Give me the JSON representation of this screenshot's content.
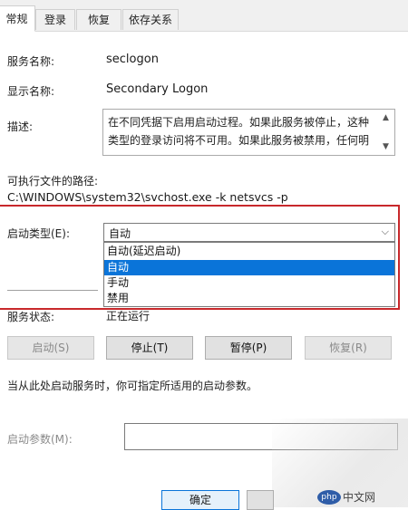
{
  "tabs": [
    {
      "label": "常规",
      "active": true
    },
    {
      "label": "登录",
      "active": false
    },
    {
      "label": "恢复",
      "active": false
    },
    {
      "label": "依存关系",
      "active": false
    }
  ],
  "service_name": {
    "label": "服务名称:",
    "value": "seclogon"
  },
  "display_name": {
    "label": "显示名称:",
    "value": "Secondary Logon"
  },
  "description": {
    "label": "描述:",
    "text": "在不同凭据下启用启动过程。如果此服务被停止，这种类型的登录访问将不可用。如果此服务被禁用，任何明"
  },
  "exe_path": {
    "label": "可执行文件的路径:",
    "value": "C:\\WINDOWS\\system32\\svchost.exe -k netsvcs -p"
  },
  "startup_type": {
    "label": "启动类型(E):",
    "selected": "自动",
    "options": [
      {
        "label": "自动(延迟启动)",
        "selected": false
      },
      {
        "label": "自动",
        "selected": true
      },
      {
        "label": "手动",
        "selected": false
      },
      {
        "label": "禁用",
        "selected": false
      }
    ]
  },
  "service_status": {
    "label": "服务状态:",
    "value": "正在运行"
  },
  "buttons": {
    "start": "启动(S)",
    "stop": "停止(T)",
    "pause": "暂停(P)",
    "resume": "恢复(R)"
  },
  "hint_text": "当从此处启动服务时，你可指定所适用的启动参数。",
  "start_params": {
    "label": "启动参数(M):",
    "value": ""
  },
  "footer": {
    "ok": "确定"
  },
  "watermark": {
    "logo": "php",
    "text": "中文网"
  },
  "colors": {
    "highlight": "#0a74d9",
    "callout_border": "#c8282b"
  }
}
